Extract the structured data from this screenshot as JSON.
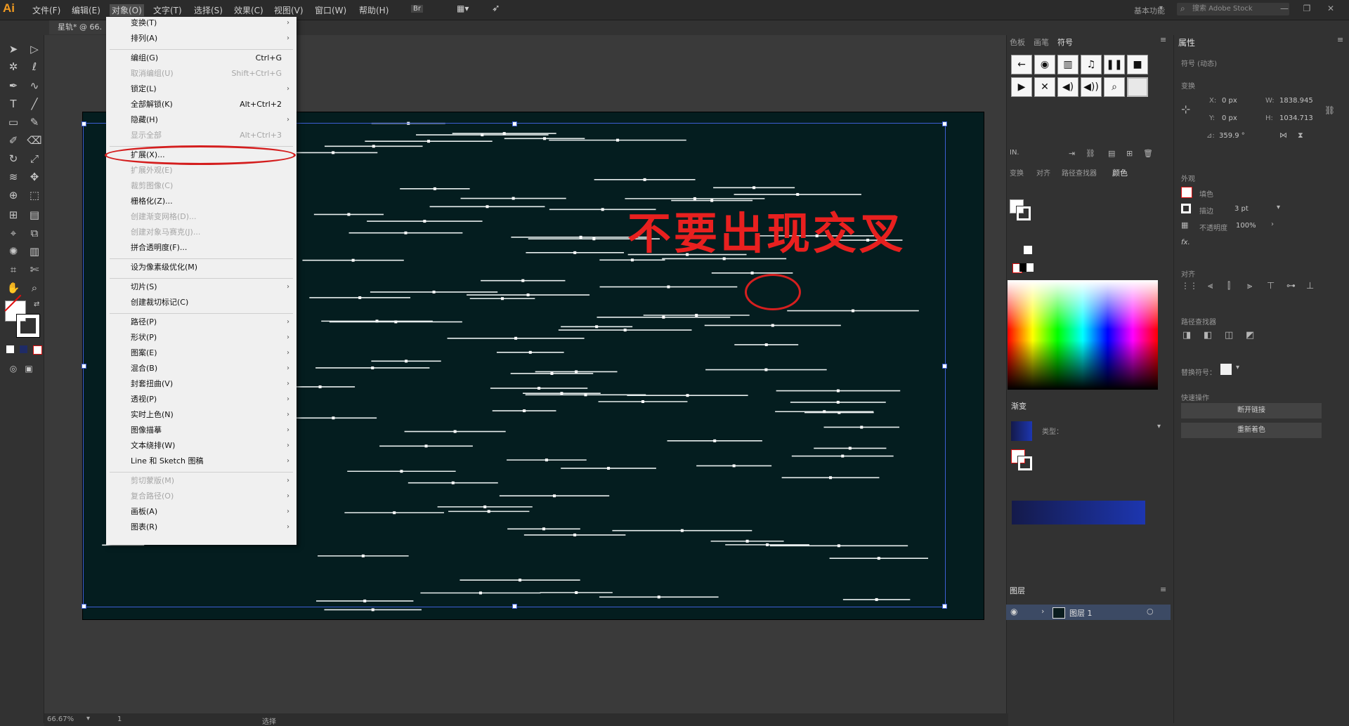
{
  "app": {
    "logo": "Ai",
    "accent": "#f29b21"
  },
  "menubar": {
    "items": [
      {
        "label": "文件(F)"
      },
      {
        "label": "编辑(E)"
      },
      {
        "label": "对象(O)"
      },
      {
        "label": "文字(T)"
      },
      {
        "label": "选择(S)"
      },
      {
        "label": "效果(C)"
      },
      {
        "label": "视图(V)"
      },
      {
        "label": "窗口(W)"
      },
      {
        "label": "帮助(H)"
      }
    ],
    "bridge_label": "Br",
    "workspace": "基本功能",
    "stock_placeholder": "搜索 Adobe Stock"
  },
  "document": {
    "tab_title": "星轨* @ 66."
  },
  "object_menu": {
    "groups": [
      [
        {
          "label": "变换(T)",
          "submenu": true
        },
        {
          "label": "排列(A)",
          "submenu": true
        }
      ],
      [
        {
          "label": "编组(G)",
          "shortcut": "Ctrl+G"
        },
        {
          "label": "取消编组(U)",
          "shortcut": "Shift+Ctrl+G",
          "disabled": true
        },
        {
          "label": "锁定(L)",
          "submenu": true
        },
        {
          "label": "全部解锁(K)",
          "shortcut": "Alt+Ctrl+2"
        },
        {
          "label": "隐藏(H)",
          "submenu": true
        },
        {
          "label": "显示全部",
          "shortcut": "Alt+Ctrl+3",
          "disabled": true
        }
      ],
      [
        {
          "label": "扩展(X)...",
          "highlighted": true
        },
        {
          "label": "扩展外观(E)",
          "disabled": true
        },
        {
          "label": "裁剪图像(C)",
          "disabled": true
        },
        {
          "label": "栅格化(Z)..."
        },
        {
          "label": "创建渐变网格(D)...",
          "disabled": true
        },
        {
          "label": "创建对象马赛克(J)...",
          "disabled": true
        },
        {
          "label": "拼合透明度(F)..."
        }
      ],
      [
        {
          "label": "设为像素级优化(M)"
        }
      ],
      [
        {
          "label": "切片(S)",
          "submenu": true
        },
        {
          "label": "创建裁切标记(C)"
        }
      ],
      [
        {
          "label": "路径(P)",
          "submenu": true
        },
        {
          "label": "形状(P)",
          "submenu": true
        },
        {
          "label": "图案(E)",
          "submenu": true
        },
        {
          "label": "混合(B)",
          "submenu": true
        },
        {
          "label": "封套扭曲(V)",
          "submenu": true
        },
        {
          "label": "透视(P)",
          "submenu": true
        },
        {
          "label": "实时上色(N)",
          "submenu": true
        },
        {
          "label": "图像描摹",
          "submenu": true
        },
        {
          "label": "文本绕排(W)",
          "submenu": true
        },
        {
          "label": "Line 和 Sketch 图稿",
          "submenu": true
        }
      ],
      [
        {
          "label": "剪切蒙版(M)",
          "submenu": true,
          "disabled": true
        },
        {
          "label": "复合路径(O)",
          "submenu": true,
          "disabled": true
        },
        {
          "label": "画板(A)",
          "submenu": true
        },
        {
          "label": "图表(R)",
          "submenu": true
        }
      ]
    ]
  },
  "annotation": {
    "text": "不要出现交叉",
    "color": "#e8201f"
  },
  "artboard": {
    "background": "#041d1f"
  },
  "mid_panel": {
    "tabs": [
      "色板",
      "画笔",
      "符号"
    ],
    "active_tab": "符号",
    "symbols": [
      "←",
      "◉",
      "▥",
      "♫",
      "❚❚",
      "■",
      "▶",
      "✕",
      "◀)",
      "◀))",
      "⌕",
      ""
    ],
    "sub_tabs": [
      "变换",
      "对齐",
      "路径查找器",
      "颜色"
    ],
    "active_sub_tab": "颜色",
    "gradient_title": "渐变",
    "gradient_type_label": "类型：",
    "layers_title": "图层",
    "layer_name": "图层 1"
  },
  "properties_panel": {
    "title": "属性",
    "subtitle": "符号 (动态)",
    "transform_label": "变换",
    "x": "0 px",
    "y": "0 px",
    "w": "1838.945",
    "h": "1034.713",
    "angle": "359.9 °",
    "appearance_label": "外观",
    "fill_label": "填色",
    "stroke_label": "描边",
    "stroke_weight": "3 pt",
    "opacity_label": "不透明度",
    "opacity": "100%",
    "fx_label": "fx.",
    "align_label": "对齐",
    "pathfinder_label": "路径查找器",
    "symbol_label": "替换符号：",
    "quick_actions_label": "快速操作",
    "break_link": "断开链接",
    "reset_color": "重新着色"
  },
  "status": {
    "zoom": "66.67%",
    "artboard_num": "1",
    "mode": "选择"
  }
}
